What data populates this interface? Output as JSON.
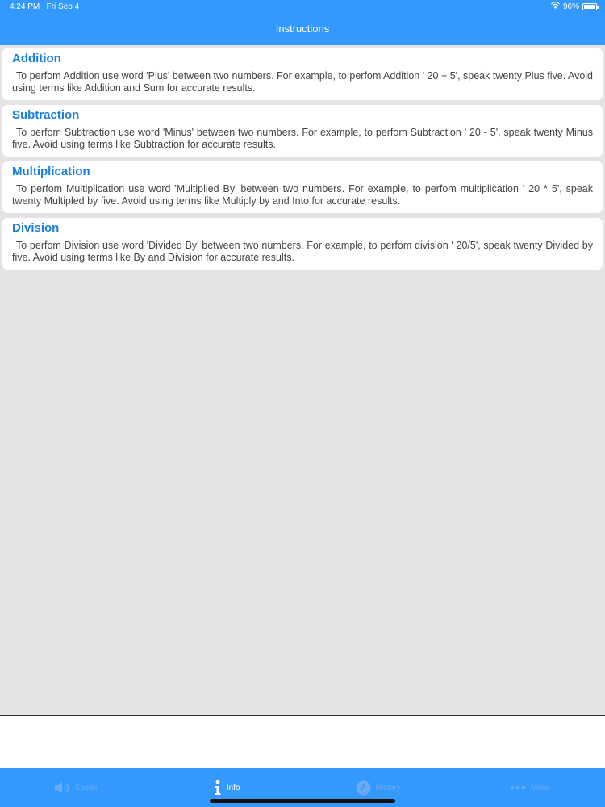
{
  "status": {
    "time": "4:24 PM",
    "date": "Fri Sep 4",
    "battery": "96%",
    "battery_level": 0.96
  },
  "nav": {
    "title": "Instructions"
  },
  "cards": [
    {
      "title": "Addition",
      "body": "To perfom Addition use word 'Plus' between two numbers. For example, to perfom Addition ' 20 + 5', speak twenty Plus five. Avoid using terms like Addition and Sum for accurate results."
    },
    {
      "title": "Subtraction",
      "body": "To perfom Subtraction use word 'Minus' between two numbers. For example, to perfom Subtraction ' 20 - 5', speak twenty Minus five. Avoid using terms like Subtraction for accurate results."
    },
    {
      "title": "Multiplication",
      "body": "To perfom Multiplication use word 'Multiplied By' between two numbers. For example, to perfom multiplication ' 20 * 5', speak twenty Multipled by five. Avoid using terms like Multiply by and Into for accurate results."
    },
    {
      "title": "Division",
      "body": "To perfom Division use word 'Divided By' between two numbers. For example, to perfom division ' 20/5', speak twenty Divided by five. Avoid using terms like By and Division for accurate results."
    }
  ],
  "tabs": [
    {
      "label": "Speak",
      "icon": "speaker-icon",
      "active": false
    },
    {
      "label": "Info",
      "icon": "info-icon",
      "active": true
    },
    {
      "label": "History",
      "icon": "history-icon",
      "active": false
    },
    {
      "label": "More",
      "icon": "more-icon",
      "active": false
    }
  ],
  "colors": {
    "accent": "#3399ff",
    "title": "#1a7fe0",
    "background": "#e4e4e6"
  }
}
